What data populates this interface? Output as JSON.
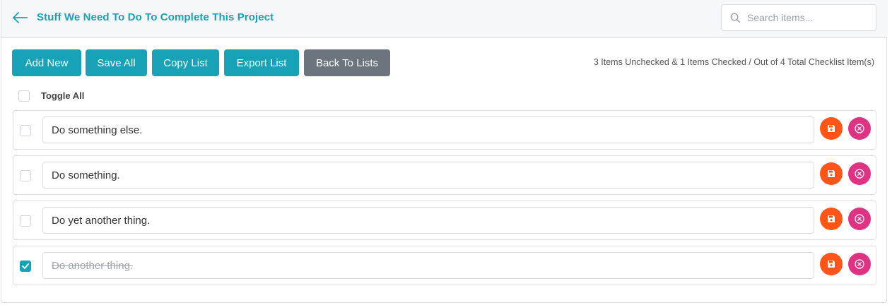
{
  "header": {
    "title": "Stuff We Need To Do To Complete This Project",
    "back_icon": "arrow-left-icon",
    "search_placeholder": "Search items...",
    "search_icon": "search-icon"
  },
  "toolbar": {
    "add_new": "Add New",
    "save_all": "Save All",
    "copy_list": "Copy List",
    "export_list": "Export List",
    "back_to_lists": "Back To Lists"
  },
  "summary": "3 Items Unchecked & 1 Items Checked / Out of 4 Total Checklist Item(s)",
  "toggle_all": {
    "label": "Toggle All",
    "checked": false
  },
  "items": [
    {
      "text": "Do something else.",
      "checked": false
    },
    {
      "text": "Do something.",
      "checked": false
    },
    {
      "text": "Do yet another thing.",
      "checked": false
    },
    {
      "text": "Do another thing.",
      "checked": true
    }
  ],
  "colors": {
    "accent": "#17a2b8",
    "secondary": "#6c757d",
    "save": "#fd5517",
    "delete": "#e03283"
  },
  "icons": {
    "save": "floppy-disk-icon",
    "delete": "circle-x-icon",
    "check": "check-icon"
  }
}
